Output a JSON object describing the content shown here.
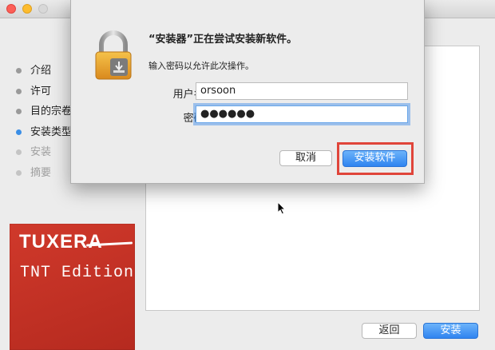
{
  "window": {
    "steps": [
      {
        "label": "介绍",
        "state": "done"
      },
      {
        "label": "许可",
        "state": "done"
      },
      {
        "label": "目的宗卷",
        "state": "done"
      },
      {
        "label": "安装类型",
        "state": "active"
      },
      {
        "label": "安装",
        "state": "pending"
      },
      {
        "label": "摘要",
        "state": "pending"
      }
    ],
    "logo": {
      "brand": "TUXERA",
      "edition": "TNT Edition"
    },
    "back_label": "返回",
    "install_label": "安装"
  },
  "dialog": {
    "title": "“安装器”正在尝试安装新软件。",
    "prompt": "输入密码以允许此次操作。",
    "username_label": "用户名:",
    "username_value": "orsoon",
    "password_label": "密码:",
    "password_mask": "●●●●●●",
    "cancel_label": "取消",
    "confirm_label": "安装软件"
  },
  "colors": {
    "accent": "#3a8ee6",
    "highlight": "#e0453a",
    "logo_bg": "#c8352a"
  },
  "icons": [
    "lock-icon",
    "mouse-cursor-icon"
  ]
}
